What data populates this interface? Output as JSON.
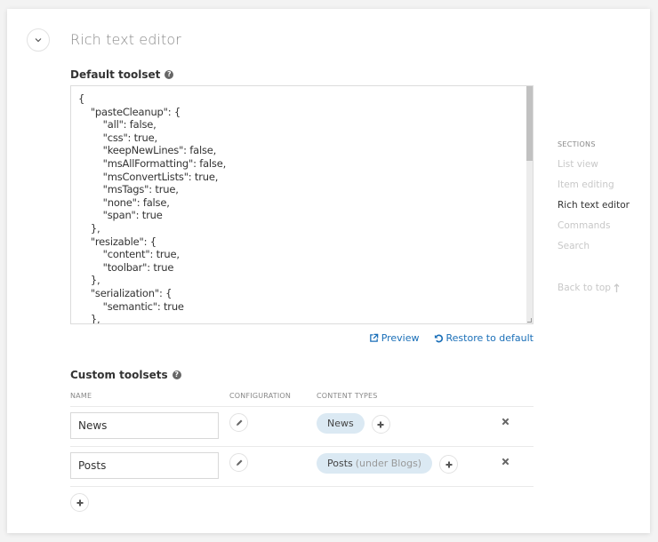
{
  "section": {
    "title": "Rich text editor",
    "collapse_icon": "chevron-down-icon"
  },
  "default_toolset": {
    "label": "Default toolset",
    "help_icon": "question-circle-icon",
    "json_text": "{\n    \"pasteCleanup\": {\n        \"all\": false,\n        \"css\": true,\n        \"keepNewLines\": false,\n        \"msAllFormatting\": false,\n        \"msConvertLists\": true,\n        \"msTags\": true,\n        \"none\": false,\n        \"span\": true\n    },\n    \"resizable\": {\n        \"content\": true,\n        \"toolbar\": true\n    },\n    \"serialization\": {\n        \"semantic\": true\n    },",
    "preview_label": "Preview",
    "restore_label": "Restore to default"
  },
  "sections_nav": {
    "heading": "SECTIONS",
    "items": [
      {
        "label": "List view",
        "active": false
      },
      {
        "label": "Item editing",
        "active": false
      },
      {
        "label": "Rich text editor",
        "active": true
      },
      {
        "label": "Commands",
        "active": false
      },
      {
        "label": "Search",
        "active": false
      }
    ],
    "back_to_top": "Back to top"
  },
  "custom_toolsets": {
    "label": "Custom toolsets",
    "help_icon": "question-circle-icon",
    "columns": [
      "NAME",
      "CONFIGURATION",
      "CONTENT TYPES"
    ],
    "rows": [
      {
        "name": "News",
        "content_types": [
          {
            "label": "News",
            "suffix": ""
          }
        ]
      },
      {
        "name": "Posts",
        "content_types": [
          {
            "label": "Posts",
            "suffix": "(under Blogs)"
          }
        ]
      }
    ]
  },
  "colors": {
    "link": "#1a6fb8",
    "chip_bg": "#dbe9f3",
    "active_nav": "#333333",
    "inactive_nav": "#c8c8c8"
  }
}
